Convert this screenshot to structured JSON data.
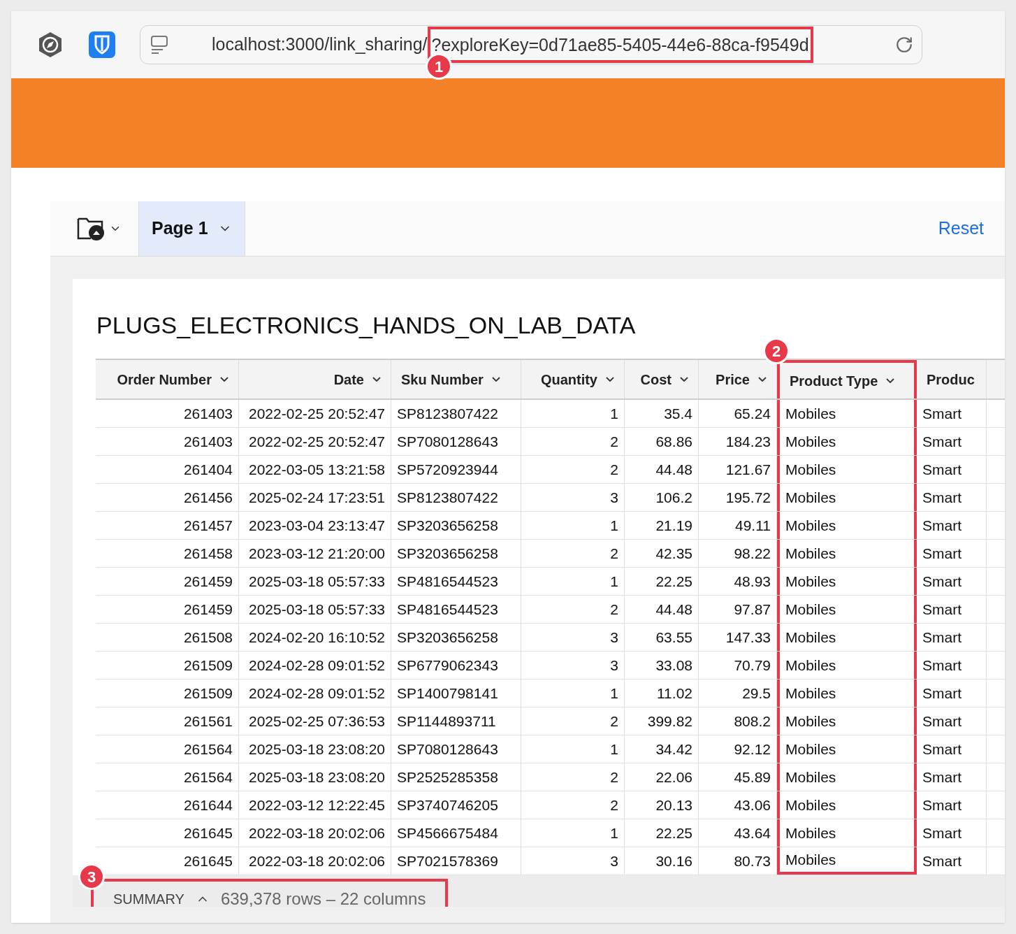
{
  "browser": {
    "url_prefix": "localhost:3000/link_sharing/",
    "url_highlight": "?exploreKey=0d71ae85-5405-44e6-88ca-f9549d",
    "callout": "1"
  },
  "toolbar": {
    "tabs": [
      {
        "label": "Page 1",
        "selected": true
      }
    ],
    "reset": "Reset"
  },
  "table": {
    "title": "PLUGS_ELECTRONICS_HANDS_ON_LAB_DATA",
    "columns": [
      {
        "label": "Order Number",
        "kind": "number",
        "highlighted": false
      },
      {
        "label": "Date",
        "kind": "number",
        "highlighted": false
      },
      {
        "label": "Sku Number",
        "kind": "text",
        "highlighted": false
      },
      {
        "label": "Quantity",
        "kind": "number",
        "highlighted": false
      },
      {
        "label": "Cost",
        "kind": "number",
        "highlighted": false
      },
      {
        "label": "Price",
        "kind": "number",
        "highlighted": false
      },
      {
        "label": "Product Type",
        "kind": "text",
        "highlighted": true,
        "callout": "2"
      },
      {
        "label": "Produc",
        "kind": "text",
        "highlighted": false
      }
    ],
    "rows": [
      [
        "261403",
        "2022-02-25 20:52:47",
        "SP8123807422",
        "1",
        "35.4",
        "65.24",
        "Mobiles",
        "Smart"
      ],
      [
        "261403",
        "2022-02-25 20:52:47",
        "SP7080128643",
        "2",
        "68.86",
        "184.23",
        "Mobiles",
        "Smart"
      ],
      [
        "261404",
        "2022-03-05 13:21:58",
        "SP5720923944",
        "2",
        "44.48",
        "121.67",
        "Mobiles",
        "Smart"
      ],
      [
        "261456",
        "2025-02-24 17:23:51",
        "SP8123807422",
        "3",
        "106.2",
        "195.72",
        "Mobiles",
        "Smart"
      ],
      [
        "261457",
        "2023-03-04 23:13:47",
        "SP3203656258",
        "1",
        "21.19",
        "49.11",
        "Mobiles",
        "Smart"
      ],
      [
        "261458",
        "2023-03-12 21:20:00",
        "SP3203656258",
        "2",
        "42.35",
        "98.22",
        "Mobiles",
        "Smart"
      ],
      [
        "261459",
        "2025-03-18 05:57:33",
        "SP4816544523",
        "1",
        "22.25",
        "48.93",
        "Mobiles",
        "Smart"
      ],
      [
        "261459",
        "2025-03-18 05:57:33",
        "SP4816544523",
        "2",
        "44.48",
        "97.87",
        "Mobiles",
        "Smart"
      ],
      [
        "261508",
        "2024-02-20 16:10:52",
        "SP3203656258",
        "3",
        "63.55",
        "147.33",
        "Mobiles",
        "Smart"
      ],
      [
        "261509",
        "2024-02-28 09:01:52",
        "SP6779062343",
        "3",
        "33.08",
        "70.79",
        "Mobiles",
        "Smart"
      ],
      [
        "261509",
        "2024-02-28 09:01:52",
        "SP1400798141",
        "1",
        "11.02",
        "29.5",
        "Mobiles",
        "Smart"
      ],
      [
        "261561",
        "2025-02-25 07:36:53",
        "SP1144893711",
        "2",
        "399.82",
        "808.2",
        "Mobiles",
        "Smart"
      ],
      [
        "261564",
        "2025-03-18 23:08:20",
        "SP7080128643",
        "1",
        "34.42",
        "92.12",
        "Mobiles",
        "Smart"
      ],
      [
        "261564",
        "2025-03-18 23:08:20",
        "SP2525285358",
        "2",
        "22.06",
        "45.89",
        "Mobiles",
        "Smart"
      ],
      [
        "261644",
        "2022-03-12 12:22:45",
        "SP3740746205",
        "2",
        "20.13",
        "43.06",
        "Mobiles",
        "Smart"
      ],
      [
        "261645",
        "2022-03-18 20:02:06",
        "SP4566675484",
        "1",
        "22.25",
        "43.64",
        "Mobiles",
        "Smart"
      ],
      [
        "261645",
        "2022-03-18 20:02:06",
        "SP7021578369",
        "3",
        "30.16",
        "80.73",
        "Mobiles",
        "Smart"
      ]
    ]
  },
  "summary": {
    "label": "SUMMARY",
    "counts": "639,378 rows – 22 columns",
    "callout": "3"
  }
}
